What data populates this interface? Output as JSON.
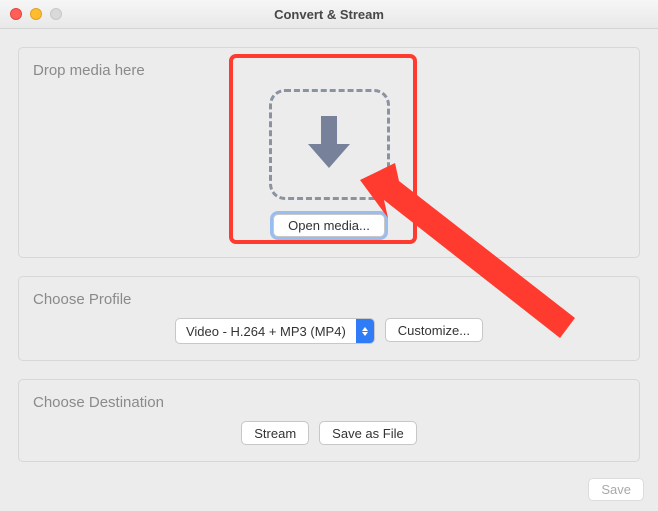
{
  "window": {
    "title": "Convert & Stream"
  },
  "sections": {
    "drop": {
      "title": "Drop media here",
      "open_button": "Open media..."
    },
    "profile": {
      "title": "Choose Profile",
      "selected": "Video - H.264 + MP3 (MP4)",
      "customize_button": "Customize..."
    },
    "destination": {
      "title": "Choose Destination",
      "stream_button": "Stream",
      "save_file_button": "Save as File"
    }
  },
  "footer": {
    "save_button": "Save"
  },
  "colors": {
    "annotation": "#ff3b2f",
    "accent": "#2f7cf6"
  }
}
